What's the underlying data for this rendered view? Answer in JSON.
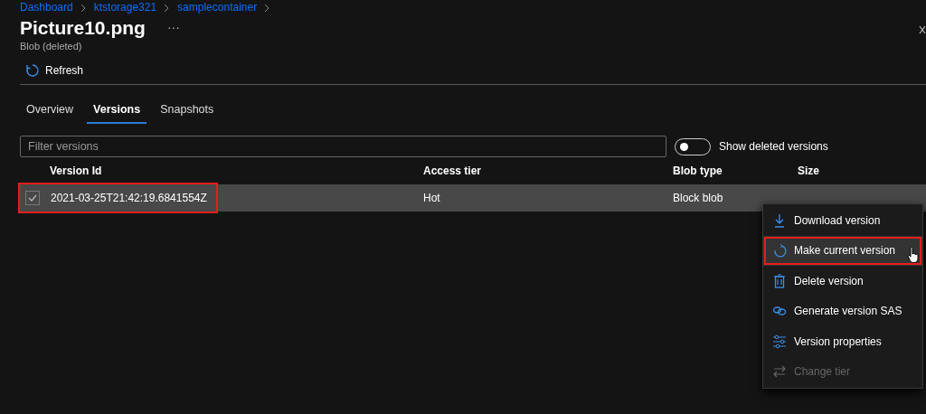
{
  "breadcrumb": [
    "Dashboard",
    "ktstorage321",
    "samplecontainer"
  ],
  "title": "Picture10.png",
  "subtitle": "Blob (deleted)",
  "more": "···",
  "toolbar": [
    {
      "label": "Refresh"
    }
  ],
  "tabs": [
    {
      "label": "Overview",
      "selected": false
    },
    {
      "label": "Versions",
      "selected": true
    },
    {
      "label": "Snapshots",
      "selected": false
    }
  ],
  "filter": {
    "placeholder": "Filter versions"
  },
  "show_deleted": {
    "label": "Show deleted versions",
    "on": false
  },
  "table": {
    "columns": [
      "Version Id",
      "Access tier",
      "Blob type",
      "Size"
    ],
    "rows": [
      {
        "cells": [
          "2021-03-25T21:42:19.6841554Z",
          "Hot",
          "Block blob"
        ],
        "selected": true,
        "checked": true,
        "highlighted": true
      }
    ]
  },
  "context_menu": [
    {
      "kind": "download",
      "label": "Download version",
      "disabled": false,
      "hovered": false,
      "highlighted": false
    },
    {
      "kind": "restore",
      "label": "Make current version",
      "disabled": false,
      "hovered": true,
      "highlighted": true
    },
    {
      "kind": "delete",
      "label": "Delete version",
      "disabled": false,
      "hovered": false,
      "highlighted": false
    },
    {
      "kind": "link",
      "label": "Generate version SAS",
      "disabled": false,
      "hovered": false,
      "highlighted": false
    },
    {
      "kind": "properties",
      "label": "Version properties",
      "disabled": false,
      "hovered": false,
      "highlighted": false
    },
    {
      "kind": "swap",
      "label": "Change tier",
      "disabled": true,
      "hovered": false,
      "highlighted": false
    }
  ]
}
